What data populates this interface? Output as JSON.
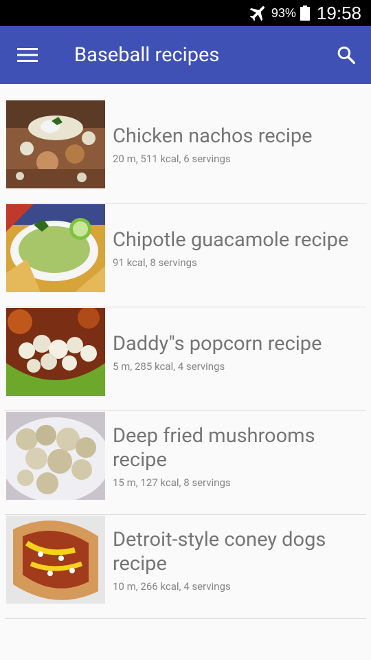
{
  "status": {
    "battery_pct": "93%",
    "time": "19:58"
  },
  "appbar": {
    "title": "Baseball recipes"
  },
  "recipes": [
    {
      "title": "Chicken nachos recipe",
      "meta": "20 m, 511 kcal, 6 servings"
    },
    {
      "title": "Chipotle guacamole recipe",
      "meta": "91 kcal, 8 servings"
    },
    {
      "title": "Daddy\"s popcorn recipe",
      "meta": "5 m, 285 kcal, 4 servings"
    },
    {
      "title": "Deep fried mushrooms recipe",
      "meta": "15 m, 127 kcal, 8 servings"
    },
    {
      "title": "Detroit-style coney dogs recipe",
      "meta": "10 m, 266 kcal, 4 servings"
    }
  ],
  "colors": {
    "appbar": "#3f51b5",
    "status_bar": "#000000",
    "title_text": "#757575"
  },
  "icons": [
    "airplane-mode-icon",
    "battery-icon",
    "menu-icon",
    "search-icon"
  ]
}
